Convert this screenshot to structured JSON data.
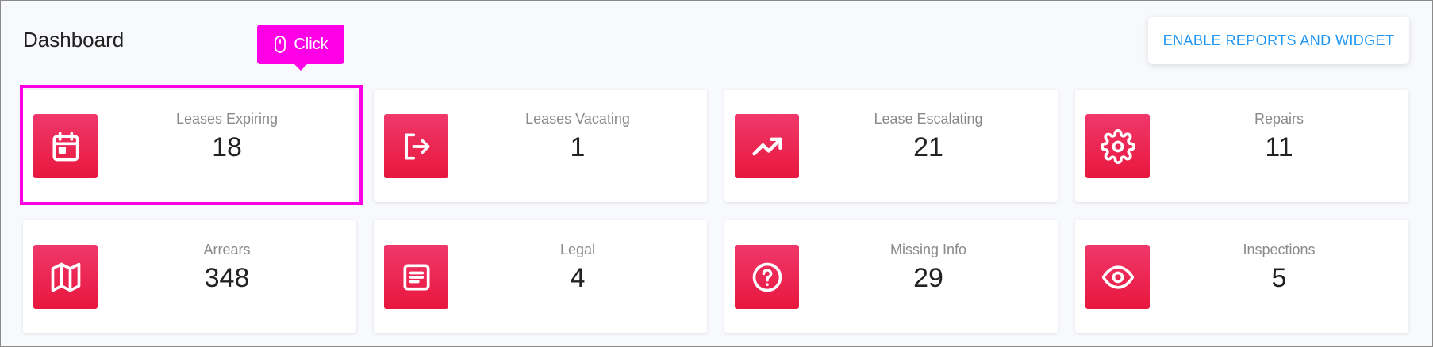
{
  "header": {
    "title": "Dashboard",
    "enable_button": "ENABLE REPORTS AND WIDGET"
  },
  "annotation": {
    "tooltip_label": "Click"
  },
  "cards": [
    {
      "label": "Leases Expiring",
      "value": "18",
      "icon": "calendar-icon"
    },
    {
      "label": "Leases Vacating",
      "value": "1",
      "icon": "exit-icon"
    },
    {
      "label": "Lease Escalating",
      "value": "21",
      "icon": "trending-up-icon"
    },
    {
      "label": "Repairs",
      "value": "11",
      "icon": "gear-icon"
    },
    {
      "label": "Arrears",
      "value": "348",
      "icon": "map-icon"
    },
    {
      "label": "Legal",
      "value": "4",
      "icon": "document-icon"
    },
    {
      "label": "Missing Info",
      "value": "29",
      "icon": "help-icon"
    },
    {
      "label": "Inspections",
      "value": "5",
      "icon": "eye-icon"
    }
  ],
  "colors": {
    "accent": "#2196f3",
    "icon_gradient_top": "#f0386b",
    "icon_gradient_bottom": "#e8173d",
    "highlight": "#ff00e6"
  }
}
